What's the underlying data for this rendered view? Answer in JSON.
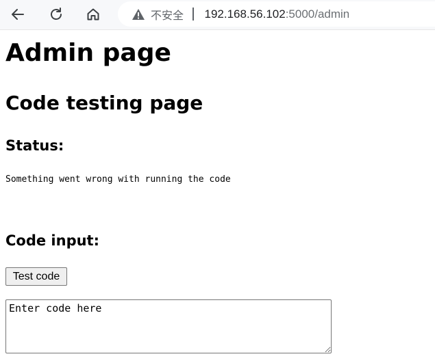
{
  "browser": {
    "security_label": "不安全",
    "url_host": "192.168.56.102",
    "url_rest": ":5000/admin",
    "icons": {
      "back": "back-arrow-icon",
      "reload": "reload-icon",
      "home": "home-icon",
      "warning": "warning-icon"
    }
  },
  "page": {
    "title": "Admin page",
    "subtitle": "Code testing page",
    "status_heading": "Status:",
    "status_message": "Something went wrong with running the code",
    "input_heading": "Code input:",
    "test_button_label": "Test code",
    "code_placeholder": "Enter code here"
  }
}
